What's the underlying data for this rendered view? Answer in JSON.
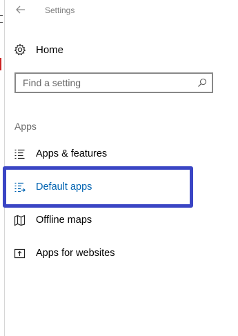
{
  "window": {
    "title": "Settings",
    "back_icon": "back-arrow-icon"
  },
  "home": {
    "label": "Home",
    "icon": "gear-icon"
  },
  "search": {
    "placeholder": "Find a setting",
    "value": "",
    "icon": "search-icon"
  },
  "section": {
    "header": "Apps"
  },
  "nav": {
    "items": [
      {
        "label": "Apps & features",
        "icon": "list-icon",
        "selected": false
      },
      {
        "label": "Default apps",
        "icon": "default-apps-icon",
        "selected": true
      },
      {
        "label": "Offline maps",
        "icon": "map-icon",
        "selected": false
      },
      {
        "label": "Apps for websites",
        "icon": "open-in-app-icon",
        "selected": false
      }
    ]
  },
  "colors": {
    "accent": "#0063b1",
    "highlight_border": "#3a45c4",
    "text": "#000000",
    "muted": "#6b6b6b"
  }
}
